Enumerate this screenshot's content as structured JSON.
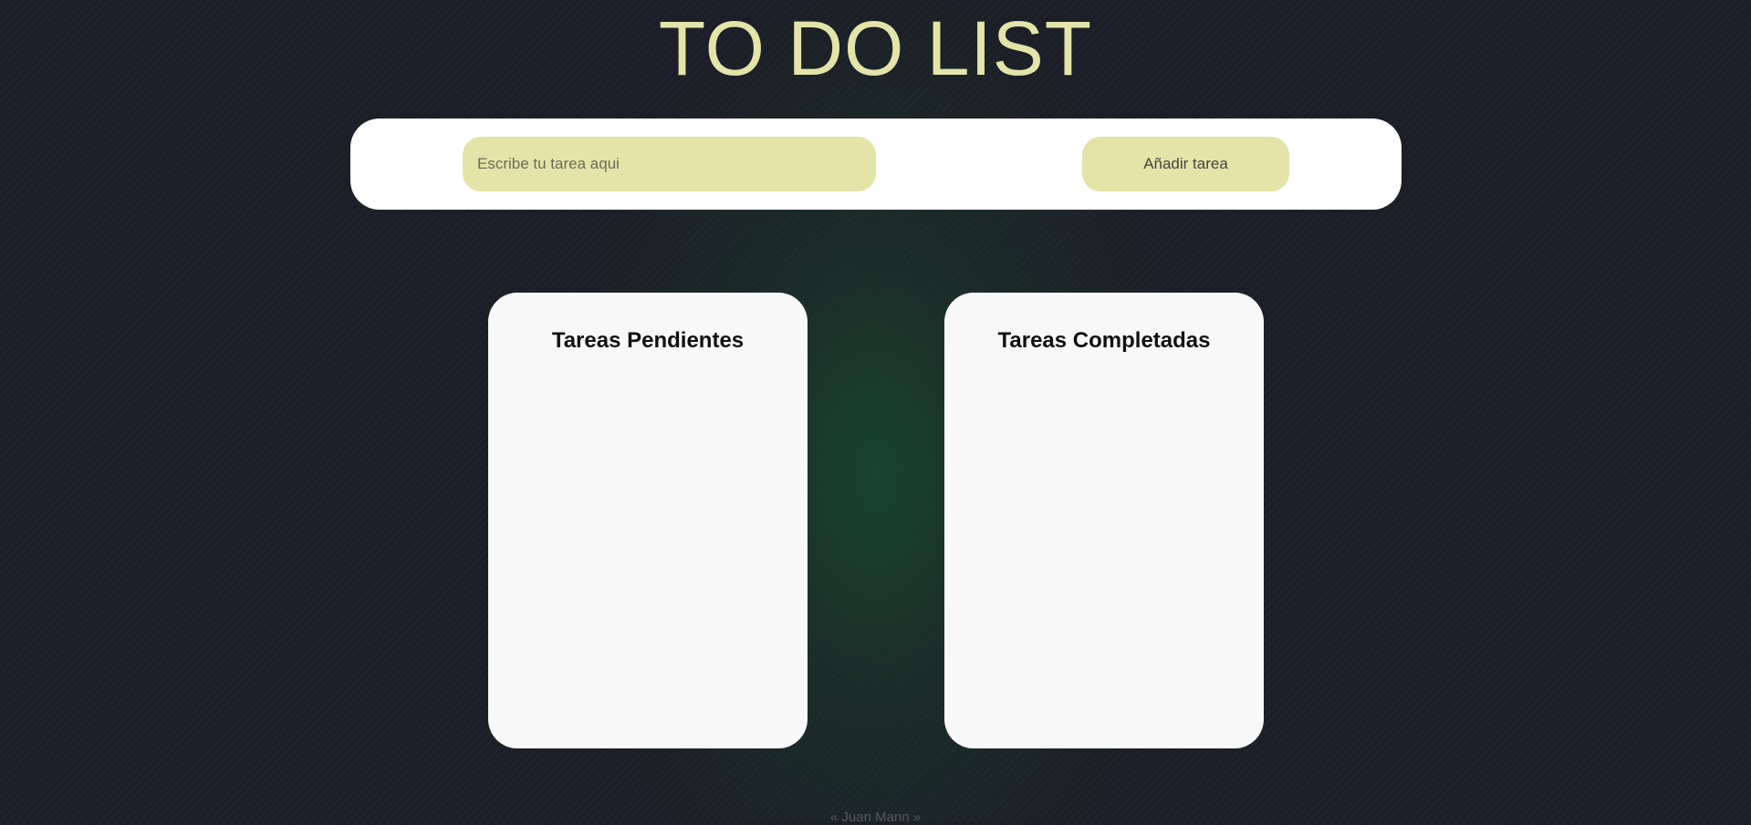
{
  "header": {
    "title": "TO DO LIST"
  },
  "form": {
    "input_value": "",
    "input_placeholder": "Escribe tu tarea aqui",
    "add_button_label": "Añadir tarea"
  },
  "lists": {
    "pending": {
      "title": "Tareas Pendientes",
      "items": []
    },
    "completed": {
      "title": "Tareas Completadas",
      "items": []
    }
  },
  "footer": {
    "text": "« Juan Mann »"
  },
  "colors": {
    "background": "#1b1e26",
    "glow": "#185030",
    "accent": "#e4e4a8",
    "panel": "#ffffff",
    "card": "#f8f8f8"
  }
}
